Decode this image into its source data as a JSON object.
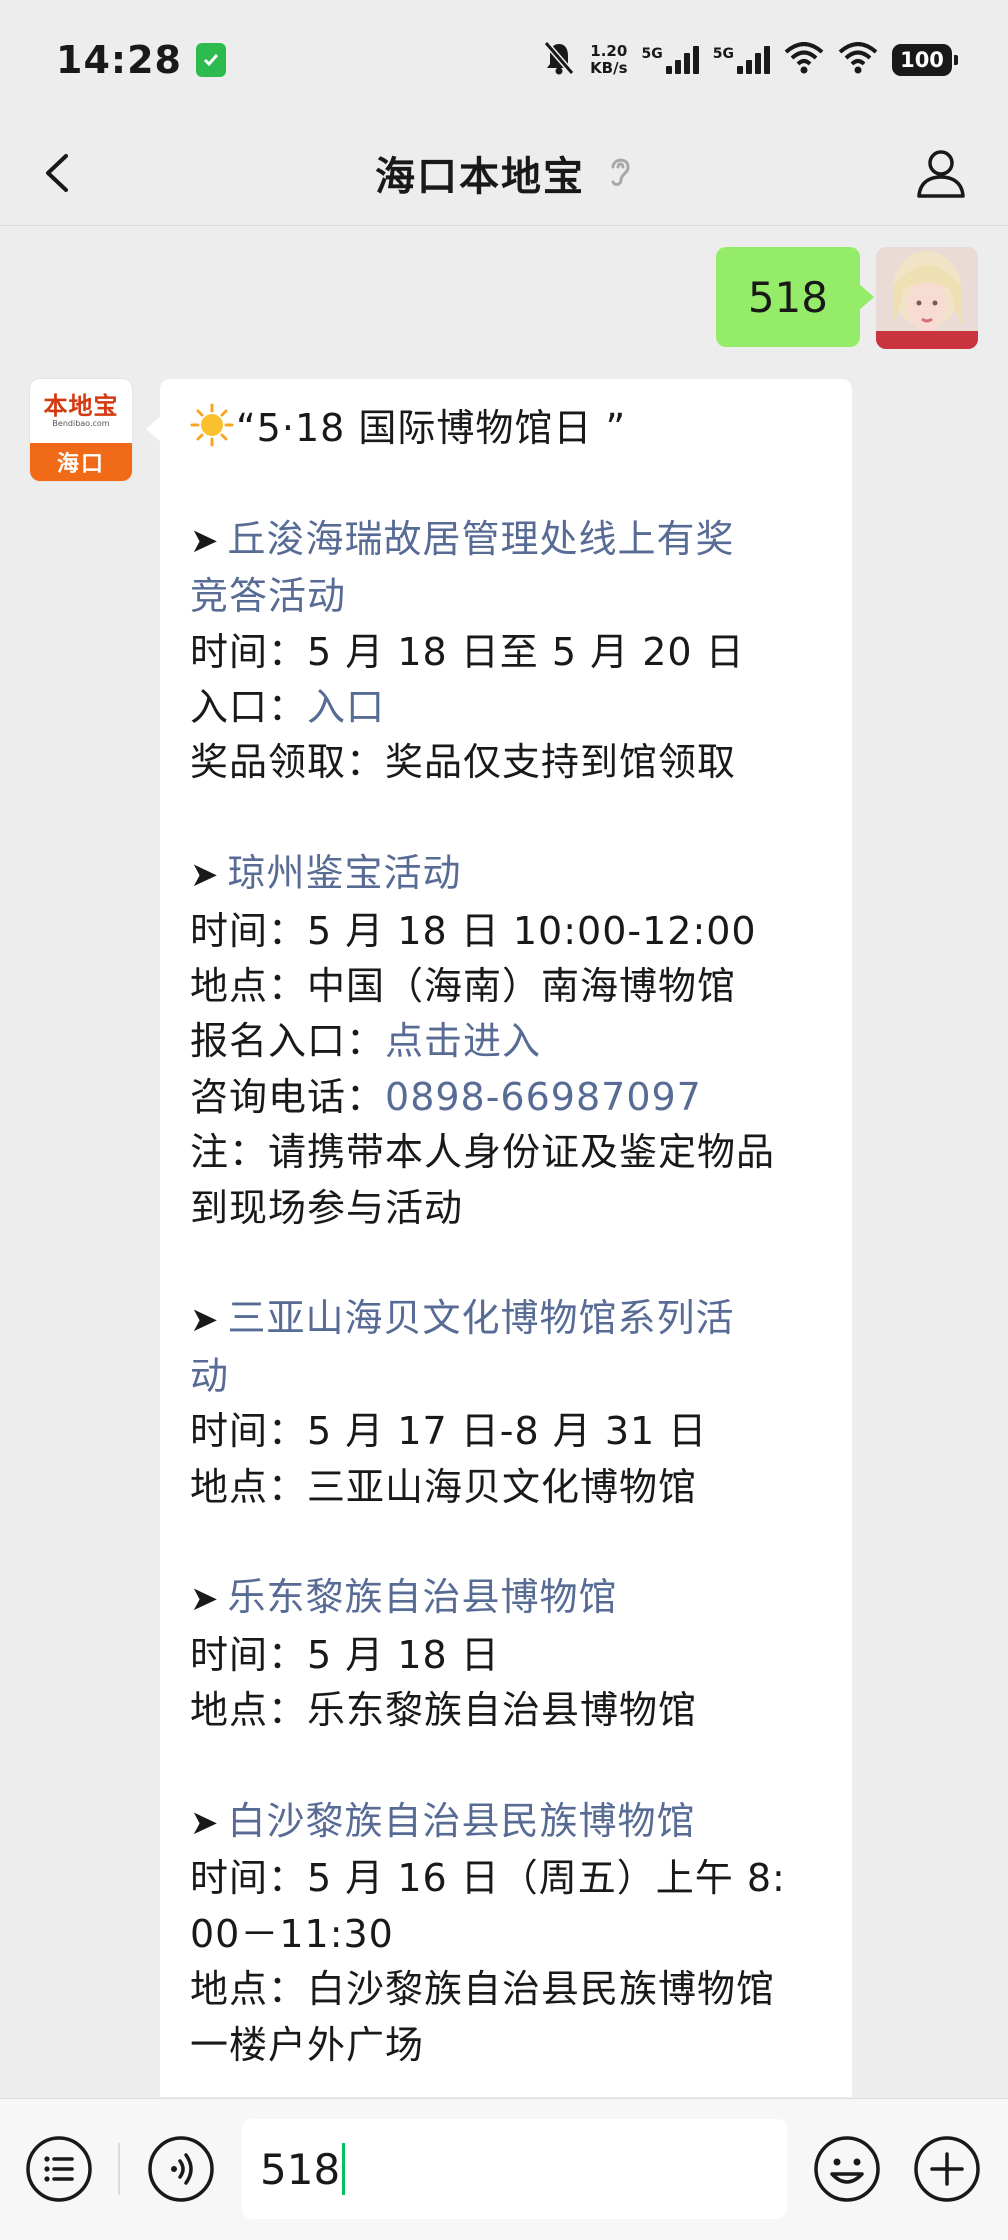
{
  "status_bar": {
    "time": "14:28",
    "net_speed_value": "1.20",
    "net_speed_unit": "KB/s",
    "sim1_label": "5G",
    "sim2_label": "5G",
    "battery": "100"
  },
  "nav": {
    "title": "海口本地宝"
  },
  "my_message": {
    "text": "518"
  },
  "bot_avatar": {
    "brand": "本地宝",
    "brand_url": "Bendibao.com",
    "city": "海口"
  },
  "bot_message": {
    "header": "“5·18 国际博物馆日 ”",
    "arrow": "➤",
    "events": [
      {
        "title_lines": [
          "丘浚海瑞故居管理处线上有奖",
          "竞答活动"
        ],
        "time_label": "时间：",
        "time_value": "5 月 18 日至 5 月 20 日",
        "entry_label": "入口：",
        "entry_link": "入口",
        "prize_label": "奖品领取：",
        "prize_value": "奖品仅支持到馆领取"
      },
      {
        "title_lines": [
          "琼州鉴宝活动"
        ],
        "time_label": "时间：",
        "time_value": "5 月 18 日 10:00-12:00",
        "place_label": "地点：",
        "place_value": "中国（海南）南海博物馆",
        "signup_label": "报名入口：",
        "signup_link": "点击进入",
        "phone_label": "咨询电话：",
        "phone_link": "0898-66987097",
        "note_lines": [
          "注：请携带本人身份证及鉴定物品",
          "到现场参与活动"
        ]
      },
      {
        "title_lines": [
          "三亚山海贝文化博物馆系列活",
          "动"
        ],
        "time_label": "时间：",
        "time_value": "5 月 17 日-8 月 31 日",
        "place_label": "地点：",
        "place_value": "三亚山海贝文化博物馆"
      },
      {
        "title_lines": [
          "乐东黎族自治县博物馆"
        ],
        "time_label": "时间：",
        "time_value": "5 月 18 日",
        "place_label": "地点：",
        "place_value": "乐东黎族自治县博物馆"
      },
      {
        "title_lines": [
          "白沙黎族自治县民族博物馆"
        ],
        "time_lines": [
          "时间：5 月 16 日（周五）上午 8:",
          "00－11:30"
        ],
        "place_lines": [
          "地点：白沙黎族自治县民族博物馆",
          "一楼户外广场"
        ]
      }
    ]
  },
  "input_bar": {
    "value": "518",
    "icons": [
      "menu-list-icon",
      "voice-icon",
      "emoji-icon",
      "plus-icon"
    ]
  },
  "colors": {
    "link": "#576b95",
    "my_bubble": "#95ec69",
    "background": "#ededed",
    "brand_orange": "#f06a18",
    "caret": "#07c160"
  }
}
